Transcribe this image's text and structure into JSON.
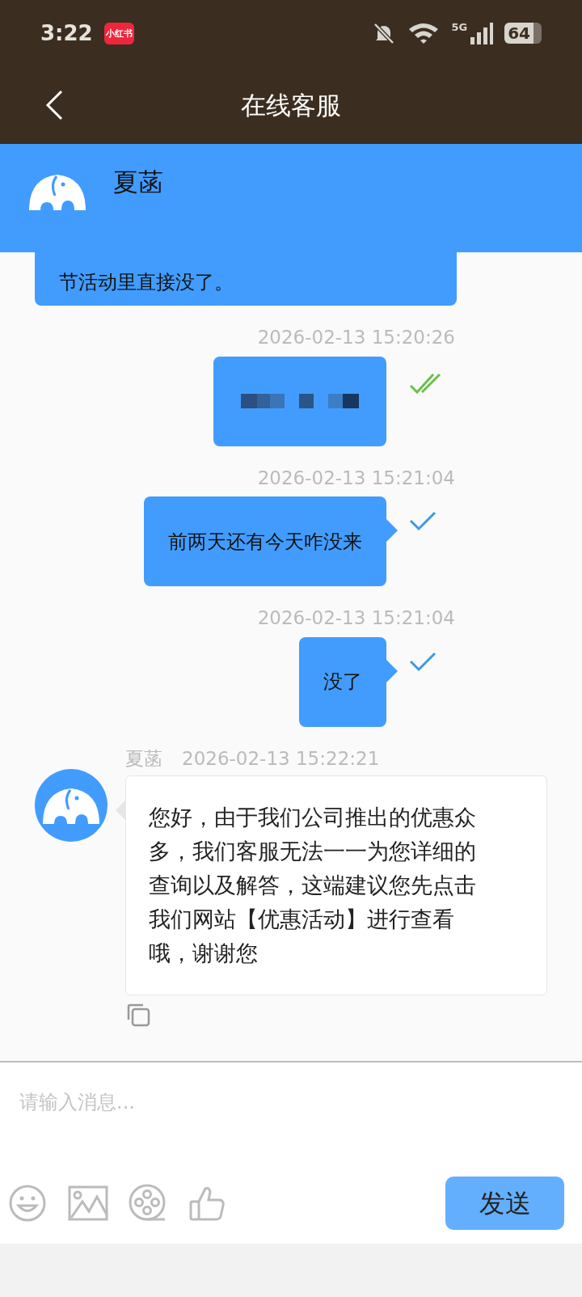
{
  "status_bar": {
    "time": "3:22",
    "app_badge": "小红书",
    "network": "5G",
    "battery": "64"
  },
  "header": {
    "title": "在线客服"
  },
  "agent_banner": {
    "name": "夏菡"
  },
  "messages": [
    {
      "kind": "incoming_partial",
      "text": "节活动里直接没了。"
    },
    {
      "kind": "outgoing",
      "time": "2026-02-13 15:20:26",
      "redacted": true,
      "read": true
    },
    {
      "kind": "outgoing",
      "time": "2026-02-13 15:21:04",
      "text": "前两天还有今天咋没来",
      "read": false
    },
    {
      "kind": "outgoing",
      "time": "2026-02-13 15:21:04",
      "text": "没了",
      "read": false
    },
    {
      "kind": "incoming",
      "sender": "夏菡",
      "time": "2026-02-13 15:22:21",
      "text": "您好，由于我们公司推出的优惠众多，我们客服无法一一为您详细的查询以及解答，这端建议您先点击我们网站【优惠活动】进行查看哦，谢谢您"
    }
  ],
  "composer": {
    "placeholder": "请输入消息...",
    "send_label": "发送"
  }
}
